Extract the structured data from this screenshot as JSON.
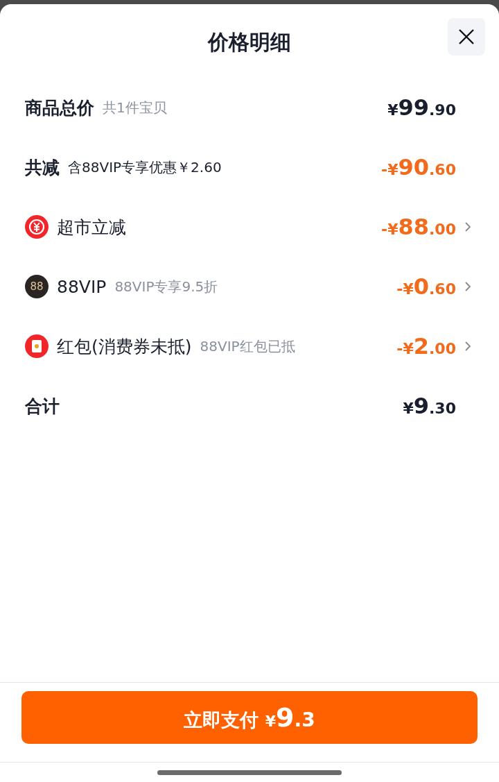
{
  "title": "价格明细",
  "rows": [
    {
      "kind": "summary",
      "label": "商品总价",
      "note": "共1件宝贝",
      "amount": {
        "prefix": "¥",
        "main": "99",
        "fraction": ".90"
      },
      "highlight": false,
      "chevron": false
    },
    {
      "kind": "summary",
      "label": "共减",
      "note": "含88VIP专享优惠￥2.60",
      "amount": {
        "prefix": "-¥",
        "main": "90",
        "fraction": ".60"
      },
      "highlight": true,
      "chevron": false
    },
    {
      "kind": "coin",
      "label": "超市立减",
      "amount": {
        "prefix": "-¥",
        "main": "88",
        "fraction": ".00"
      },
      "highlight": true,
      "chevron": true
    },
    {
      "kind": "vip",
      "label": "88VIP",
      "badge": "88",
      "note": "88VIP专享9.5折",
      "amount": {
        "prefix": "-¥",
        "main": "0",
        "fraction": ".60"
      },
      "highlight": true,
      "chevron": true
    },
    {
      "kind": "envelope",
      "label": "红包(消费券未抵)",
      "note": "88VIP红包已抵",
      "amount": {
        "prefix": "-¥",
        "main": "2",
        "fraction": ".00"
      },
      "highlight": true,
      "chevron": true
    },
    {
      "kind": "summary",
      "label": "合计",
      "amount": {
        "prefix": "¥",
        "main": "9",
        "fraction": ".30"
      },
      "highlight": false,
      "chevron": false
    }
  ],
  "pay_button": {
    "label": "立即支付",
    "prefix": "¥",
    "main": "9",
    "fraction": ".3"
  }
}
